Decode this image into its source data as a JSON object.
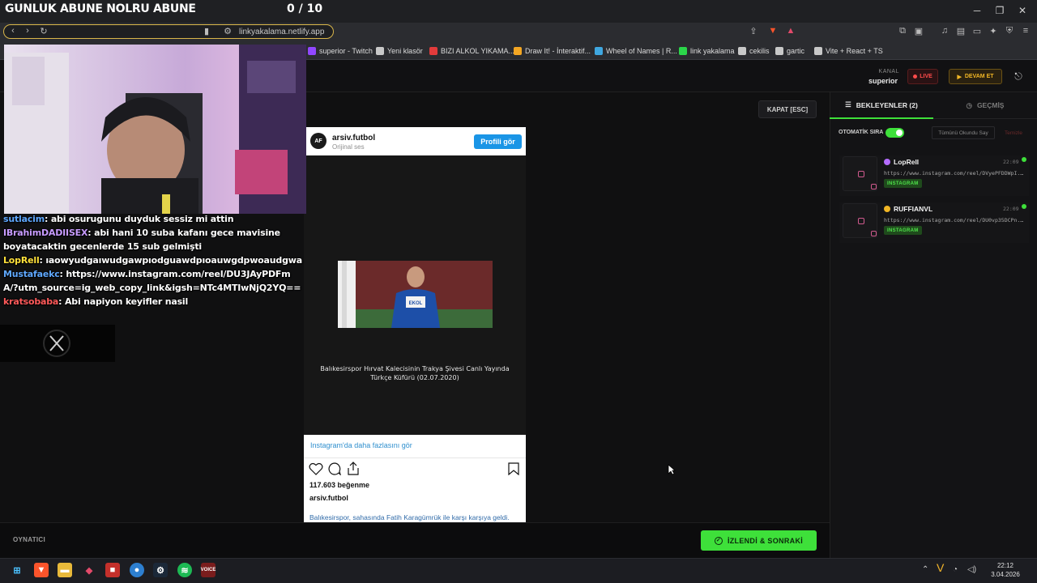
{
  "overlay": {
    "title": "GUNLUK ABUNE NOLRU ABUNE",
    "count": "0 / 10"
  },
  "browser": {
    "url": "linkyakalama.netlify.app",
    "bookmarks": [
      {
        "label": "superior - Twitch",
        "color": "#9147ff"
      },
      {
        "label": "Yeni klasör",
        "color": "#c8c8c8"
      },
      {
        "label": "BIZI ALKOL YIKAMA...",
        "color": "#e23b3b"
      },
      {
        "label": "Draw It! - İnteraktif...",
        "color": "#f3a623"
      },
      {
        "label": "Wheel of Names | R...",
        "color": "#3fa7e0"
      },
      {
        "label": "link yakalama",
        "color": "#2bd64a"
      },
      {
        "label": "cekilis",
        "color": "#c8c8c8"
      },
      {
        "label": "gartic",
        "color": "#c8c8c8"
      },
      {
        "label": "Vite + React + TS",
        "color": "#c8c8c8"
      }
    ]
  },
  "header": {
    "kanal_label": "KANAL",
    "kanal_value": "superior",
    "live_label": "LIVE",
    "devam_label": "DEVAM ET"
  },
  "player": {
    "close_label": "KAPAT [ESC]",
    "bottom_label": "OYNATICI",
    "next_label": "İZLENDİ & SONRAKİ"
  },
  "instagram": {
    "username": "arsiv.futbol",
    "audio": "Orijinal ses",
    "profile_button": "Profili gör",
    "video_caption": "Balıkesirspor Hırvat Kalecisinin Trakya Şivesi Canlı Yayında Türkçe Küfürü (02.07.2020)",
    "more_link": "Instagram'da daha fazlasını gör",
    "likes": "117.603 beğenme",
    "account": "arsiv.futbol",
    "description": "Balıkesirspor, sahasında Fatih Karagümrük ile karşı karşıya geldi."
  },
  "chat": [
    {
      "user": "sutlacim",
      "color": "#5fa8ff",
      "text": "abi osurugunu duyduk sessiz mi attin"
    },
    {
      "user": "IBrahimDADIISEX",
      "color": "#c79bff",
      "text": "abi hani 10 suba kafanı gece mavisine boyatacaktin gecenlerde 15 sub gelmişti"
    },
    {
      "user": "LopRell",
      "color": "#ffe03a",
      "text": "ıaowyudgaıwudgawpıodguawdpıoauwgdpwoaudgwa"
    },
    {
      "user": "Mustafaekc",
      "color": "#5fa8ff",
      "text": "https://www.instagram.com/reel/DU3JAyPDFmA/?utm_source=ig_web_copy_link&igsh=NTc4MTIwNjQ2YQ=="
    },
    {
      "user": "kratsobaba",
      "color": "#ff5a5a",
      "text": "Abi napiyon keyifler nasil"
    }
  ],
  "queue": {
    "tab_waiting": "BEKLEYENLER (2)",
    "tab_history": "GEÇMİŞ",
    "auto_label": "OTOMATİK SIRA",
    "mark_all": "Tümünü Okundu Say",
    "clear": "Temizle",
    "items": [
      {
        "user": "LopRell",
        "dot": "#b46cff",
        "time": "22:09",
        "url": "https://www.instagram.com/reel/DVyePFDDWpI...",
        "badge": "INSTAGRAM"
      },
      {
        "user": "RUFFIANVL",
        "dot": "#f1b625",
        "time": "22:09",
        "url": "https://www.instagram.com/reel/DU0vp35DCPn...",
        "badge": "INSTAGRAM"
      }
    ]
  },
  "taskbar": {
    "time": "22:12",
    "date": "3.04.2026"
  }
}
